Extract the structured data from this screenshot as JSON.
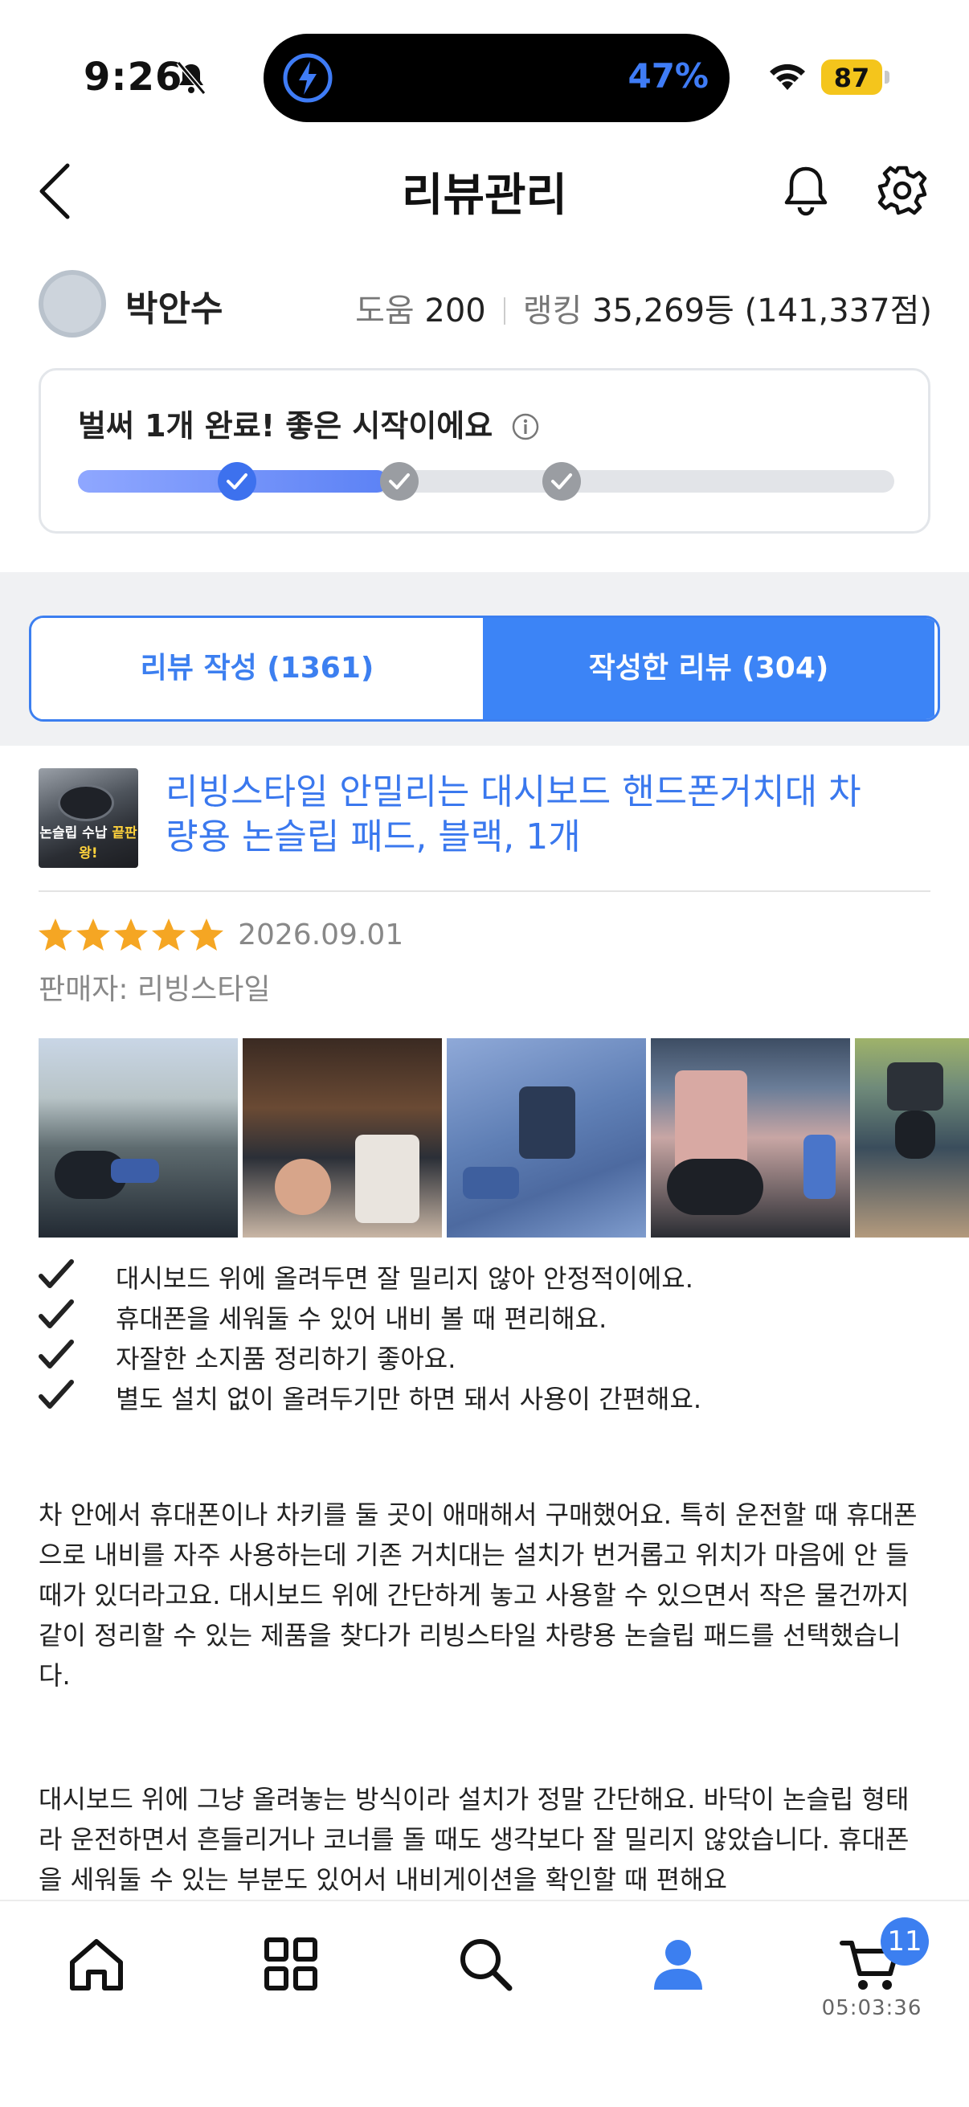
{
  "status_bar": {
    "time": "9:26",
    "battery_percent_island": "47%",
    "battery_level": "87"
  },
  "header": {
    "title": "리뷰관리"
  },
  "profile": {
    "name": "박안수",
    "help_label": "도움",
    "help_value": "200",
    "rank_label": "랭킹",
    "rank_value": "35,269등 (141,337점)"
  },
  "progress": {
    "message": "벌써 1개 완료! 좋은 시작이에요",
    "completed_steps": 1,
    "total_steps": 3,
    "fill_fraction": 0.38
  },
  "tabs": [
    {
      "label": "리뷰 작성 (1361)",
      "active": false
    },
    {
      "label": "작성한 리뷰 (304)",
      "active": true
    }
  ],
  "review": {
    "product_thumb_caption_a": "논슬립 수납",
    "product_thumb_caption_b": "끝판왕!",
    "product_title": "리빙스타일 안밀리는 대시보드 핸드폰거치대 차량용 논슬립 패드, 블랙, 1개",
    "rating": 5,
    "date": "2026.09.01",
    "seller": "판매자: 리빙스타일",
    "photo_count_visible": 5,
    "checklist": [
      "대시보드 위에 올려두면 잘 밀리지 않아 안정적이에요.",
      "휴대폰을 세워둘 수 있어 내비 볼 때 편리해요.",
      "자잘한 소지품 정리하기 좋아요.",
      "별도 설치 없이 올려두기만 하면 돼서 사용이 간편해요."
    ],
    "paragraph_1": "차 안에서 휴대폰이나 차키를 둘 곳이 애매해서 구매했어요. 특히 운전할 때 휴대폰으로 내비를 자주 사용하는데 기존 거치대는 설치가 번거롭고 위치가 마음에 안 들 때가 있더라고요. 대시보드 위에 간단하게 놓고 사용할 수 있으면서 작은 물건까지 같이 정리할 수 있는 제품을 찾다가 리빙스타일 차량용 논슬립 패드를 선택했습니다.",
    "paragraph_2": "대시보드 위에 그냥 올려놓는 방식이라 설치가 정말 간단해요. 바닥이 논슬립 형태라 운전하면서 흔들리거나 코너를 돌 때도 생각보다 잘 밀리지 않았습니다. 휴대폰을 세워둘 수 있는 부분도 있어서 내비게이션을 확인할 때 편해요"
  },
  "bottom_nav": {
    "items": [
      "home-icon",
      "category-grid-icon",
      "search-icon",
      "my-page-icon",
      "cart-icon"
    ],
    "active": "my-page-icon",
    "cart_badge": "11",
    "cart_timer": "05:03:36"
  },
  "colors": {
    "accent": "#3c7ff0",
    "star": "#f5a623",
    "text_muted": "#888888"
  }
}
